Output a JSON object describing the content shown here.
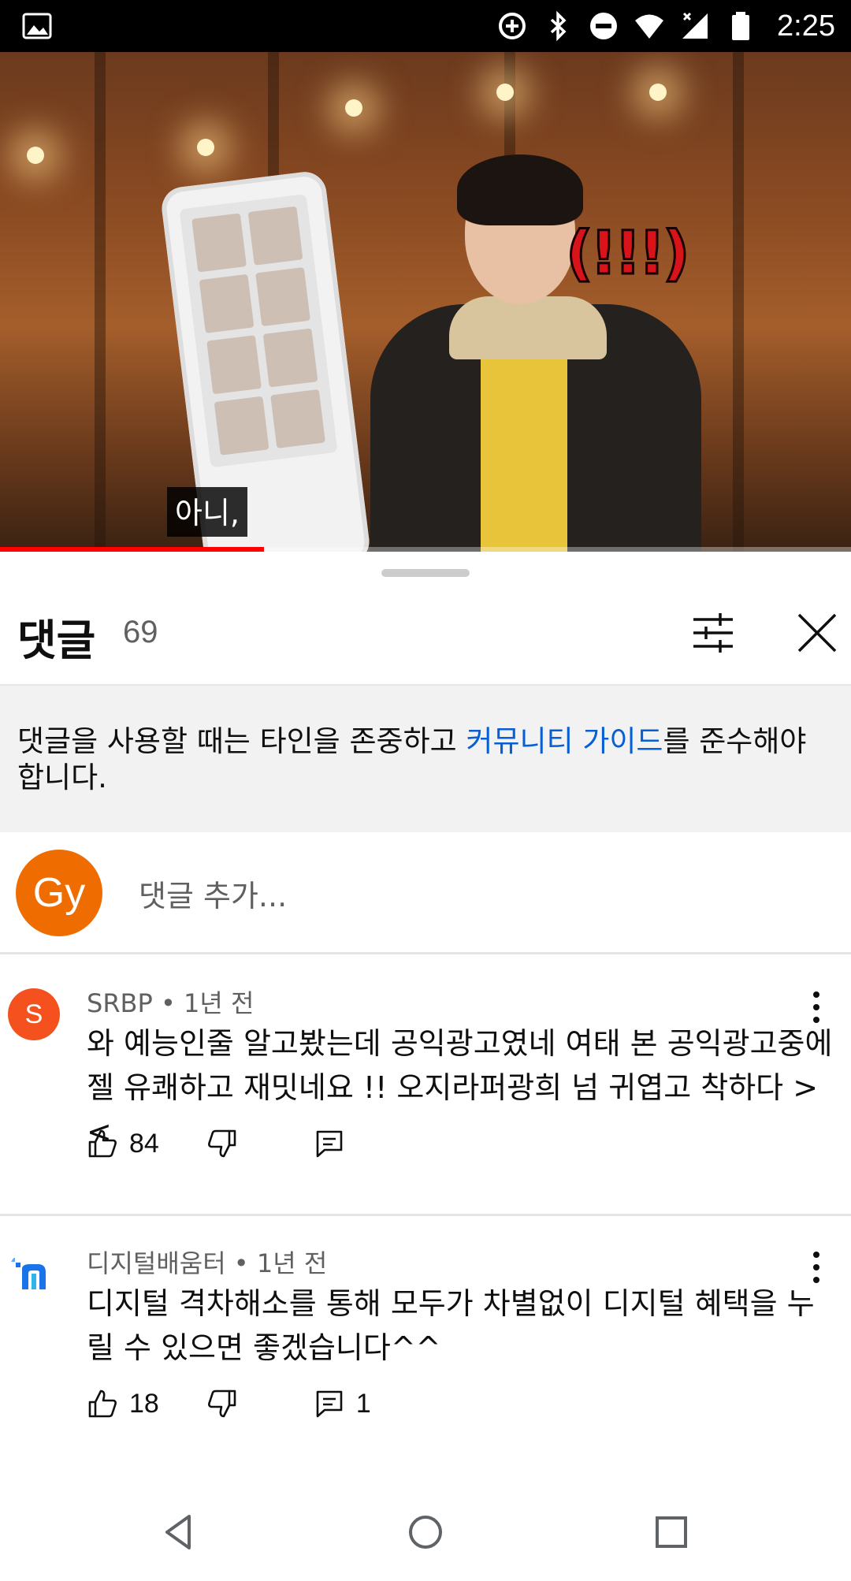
{
  "status_bar": {
    "time": "2:25",
    "icons": [
      "gallery-icon",
      "data-saver-icon",
      "bluetooth-icon",
      "do-not-disturb-icon",
      "wifi-icon",
      "signal-icon",
      "battery-icon"
    ]
  },
  "video": {
    "subtitle": "아니,",
    "overlay_text": "(!!!)",
    "progress": 0.31,
    "progress_color": "#ff0000"
  },
  "comments_panel": {
    "title": "댓글",
    "count": "69",
    "notice_prefix": "댓글을 사용할 때는 타인을 존중하고 ",
    "notice_link": "커뮤니티 가이드",
    "notice_suffix": "를 준수해야 합니다.",
    "link_color": "#065fd4",
    "user_avatar": "Gy",
    "user_avatar_color": "#ef6c00",
    "add_placeholder": "댓글 추가..."
  },
  "comments": [
    {
      "avatar": "S",
      "avatar_color": "#f4511e",
      "meta": "SRBP • 1년 전",
      "text": "와 예능인줄 알고봤는데 공익광고였네 여태 본 공익광고중에 젤 유쾌하고 재밋네요 !! 오지라퍼광희 넘 귀엽고 착하다 ><",
      "likes": "84",
      "replies": ""
    },
    {
      "avatar": "",
      "avatar_color": "#1a73e8",
      "meta": "디지털배움터 • 1년 전",
      "text": "디지털 격차해소를 통해 모두가 차별없이 디지털 혜택을 누릴 수 있으면 좋겠습니다^^",
      "likes": "18",
      "replies": "1"
    }
  ]
}
